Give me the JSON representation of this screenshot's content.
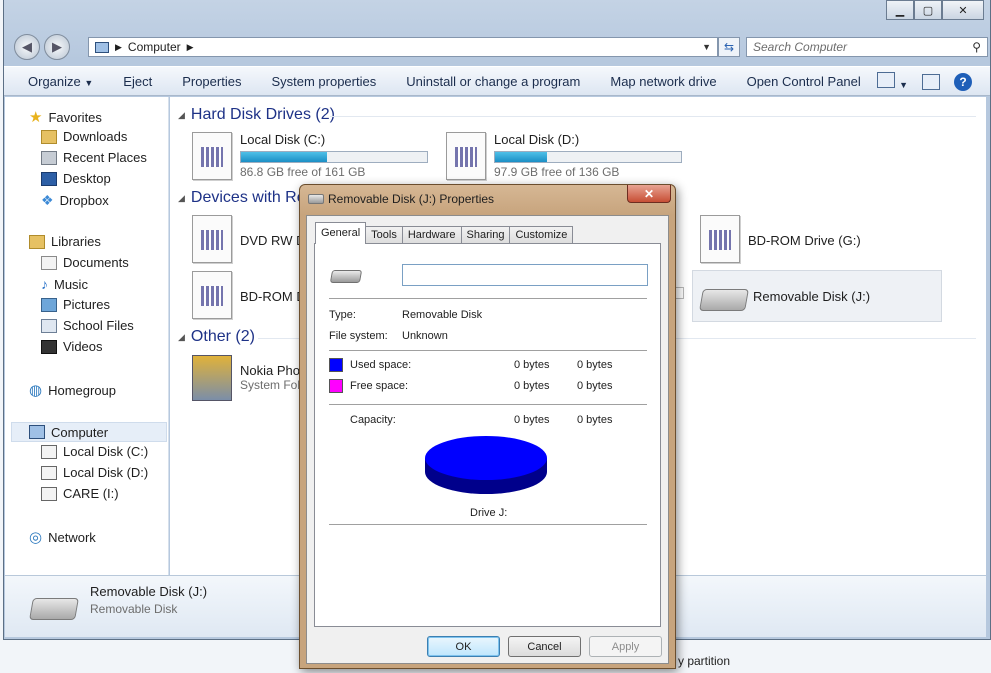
{
  "window": {
    "title_buttons": {
      "minimize": "▁",
      "maximize": "▢",
      "close": "✕"
    }
  },
  "address_bar": {
    "path": "Computer",
    "search_placeholder": "Search Computer"
  },
  "toolbar": {
    "organize": "Organize",
    "eject": "Eject",
    "properties": "Properties",
    "system_properties": "System properties",
    "uninstall": "Uninstall or change a program",
    "map_network_drive": "Map network drive",
    "open_control_panel": "Open Control Panel"
  },
  "nav": {
    "favorites": "Favorites",
    "downloads": "Downloads",
    "recent_places": "Recent Places",
    "desktop": "Desktop",
    "dropbox": "Dropbox",
    "libraries": "Libraries",
    "documents": "Documents",
    "music": "Music",
    "pictures": "Pictures",
    "school_files": "School Files",
    "videos": "Videos",
    "homegroup": "Homegroup",
    "computer": "Computer",
    "local_disk_c": "Local Disk (C:)",
    "local_disk_d": "Local Disk (D:)",
    "care_i": "CARE (I:)",
    "network": "Network"
  },
  "content": {
    "hard_disk_header": "Hard Disk Drives (2)",
    "devices_header": "Devices with Re",
    "other_header": "Other (2)",
    "drive_c": {
      "name": "Local Disk (C:)",
      "free": "86.8 GB free of 161 GB",
      "used_fraction": 0.46
    },
    "drive_d": {
      "name": "Local Disk (D:)",
      "free": "97.9 GB free of 136 GB",
      "used_fraction": 0.28
    },
    "dvd": "DVD RW Dr",
    "bdrom_partial": "BD-ROM D",
    "bdrom_g": "BD-ROM Drive (G:)",
    "removable_j": "Removable Disk (J:)",
    "nokia_name": "Nokia Phon",
    "nokia_sub": "System Fol"
  },
  "details": {
    "name": "Removable Disk (J:)",
    "type": "Removable Disk"
  },
  "partition_text": "y partition",
  "dialog": {
    "title": "Removable Disk (J:) Properties",
    "tabs": [
      "General",
      "Tools",
      "Hardware",
      "Sharing",
      "Customize"
    ],
    "type_label": "Type:",
    "type_value": "Removable Disk",
    "fs_label": "File system:",
    "fs_value": "Unknown",
    "used_label": "Used space:",
    "used_bytes": "0 bytes",
    "used_size": "0 bytes",
    "free_label": "Free space:",
    "free_bytes": "0 bytes",
    "free_size": "0 bytes",
    "capacity_label": "Capacity:",
    "capacity_bytes": "0 bytes",
    "capacity_size": "0 bytes",
    "drive_label": "Drive J:",
    "ok": "OK",
    "cancel": "Cancel",
    "apply": "Apply",
    "used_color": "#0000ff",
    "free_color": "#ff00ff"
  }
}
